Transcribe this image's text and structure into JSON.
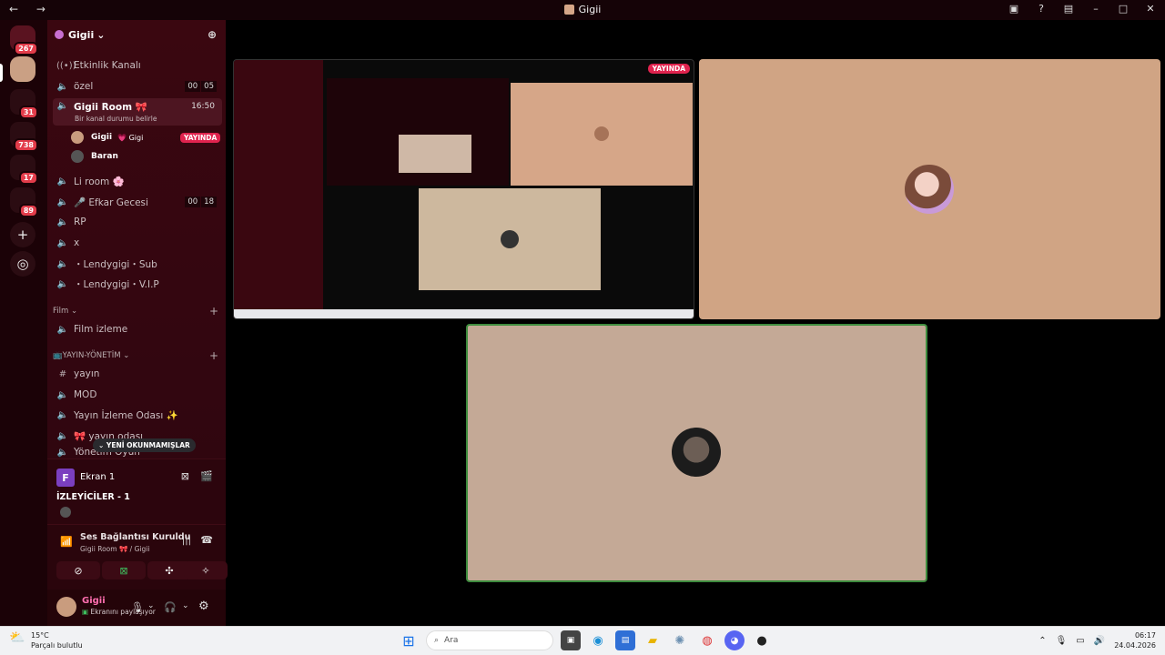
{
  "window": {
    "title": "Gigii",
    "nav": "← →"
  },
  "servers": {
    "badges": [
      "267",
      "31",
      "738",
      "17",
      "89"
    ]
  },
  "guild": {
    "name": "Gigii",
    "chevron": "⌄"
  },
  "channels": [
    {
      "name": "Etkinlik Kanalı",
      "icon": "broadcast-icon"
    },
    {
      "name": "özel",
      "icon": "speaker-icon",
      "counts": [
        "00",
        "05"
      ]
    },
    {
      "name": "Gigii Room 🎀",
      "icon": "speaker-icon",
      "time": "16:50",
      "status": "Bir kanal durumu belirle"
    },
    {
      "name": "Li room 🌸",
      "icon": "speaker-icon"
    },
    {
      "name": "🎤 Efkar Gecesi",
      "icon": "speaker-icon",
      "counts": [
        "00",
        "18"
      ]
    },
    {
      "name": "RP",
      "icon": "speaker-icon"
    },
    {
      "name": "x",
      "icon": "speaker-icon"
    },
    {
      "name": "・Lendygigi・Sub",
      "icon": "speaker-icon"
    },
    {
      "name": "・Lendygigi・V.I.P",
      "icon": "speaker-icon"
    }
  ],
  "members": [
    {
      "name": "Gigii",
      "tag": "💗 Gigi",
      "live": "YAYINDA"
    },
    {
      "name": "Baran"
    }
  ],
  "categories": [
    {
      "name": "Film",
      "channels": [
        "Film izleme"
      ]
    },
    {
      "name": "📺YAYIN-YÖNETİM",
      "channels": [
        "yayın",
        "MOD",
        "Yayın İzleme Odası ✨",
        "🎀 yayın odası",
        "Yönetim Oyun"
      ]
    }
  ],
  "unread_label": "⌄ YENİ OKUNMAMIŞLAR",
  "screen_share": {
    "title": "Ekran 1",
    "viewers_label": "İZLEYİCİLER - 1",
    "letter": "F"
  },
  "voice": {
    "status": "Ses Bağlantısı Kuruldu",
    "location": "Gigii Room 🎀 / Gigii"
  },
  "user": {
    "name": "Gigii",
    "status": "Ekranını paylaşıyor"
  },
  "stage": {
    "live_badge": "YAYINDA"
  },
  "taskbar": {
    "weather_temp": "15°C",
    "weather_desc": "Parçalı bulutlu",
    "search_placeholder": "Ara",
    "time": "06:17",
    "date": "24.04.2026"
  },
  "colors": {
    "accent": "#e0234e",
    "sidebar_bg": "#3a0710",
    "cam_bg": "#d0a484"
  }
}
